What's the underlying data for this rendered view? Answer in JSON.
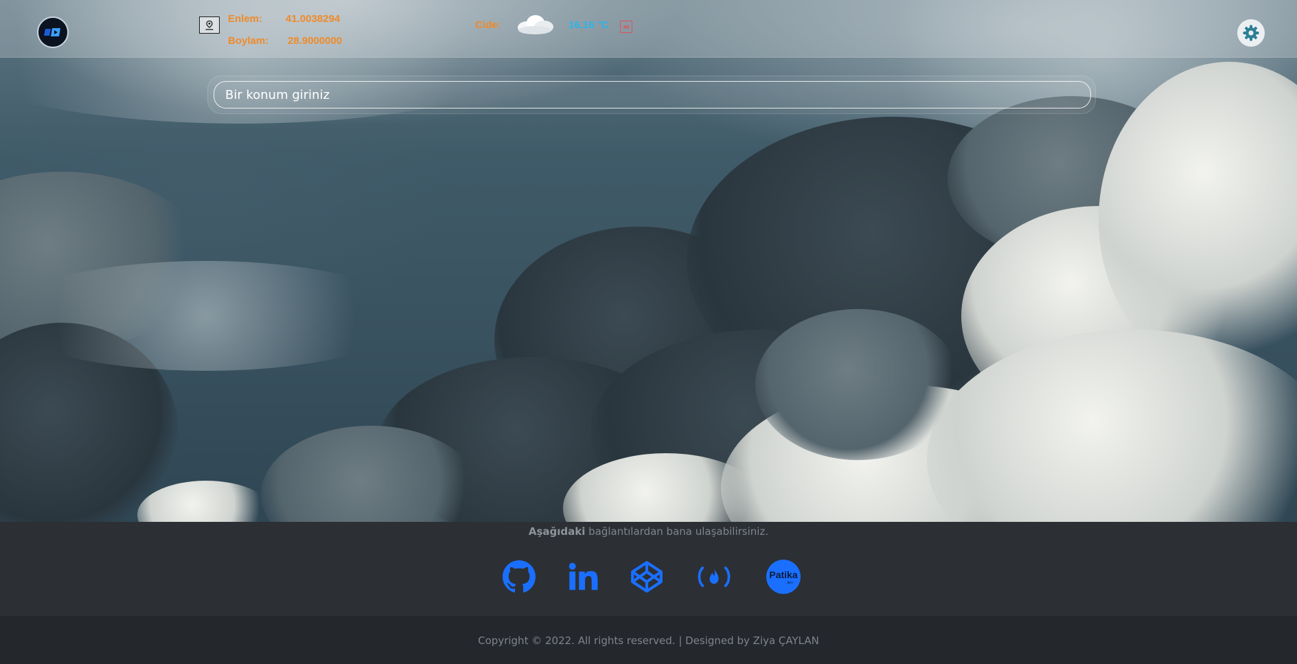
{
  "header": {
    "logo_alt": "logo",
    "location_icon": "map-pin-icon",
    "latitude_label": "Enlem:",
    "latitude_value": "41.0038294",
    "longitude_label": "Boylam:",
    "longitude_value": "28.9000000",
    "city": "Cide:",
    "weather_icon": "cloud-icon",
    "temperature": "16.16 °C",
    "settings_icon": "gear-icon"
  },
  "search": {
    "placeholder": "Bir konum giriniz"
  },
  "contact": {
    "intro_bold": "Aşağıdaki",
    "intro_rest": " bağlantılardan bana ulaşabilirsiniz.",
    "links": [
      {
        "name": "github",
        "icon": "github-icon"
      },
      {
        "name": "linkedin",
        "icon": "linkedin-icon"
      },
      {
        "name": "codepen",
        "icon": "codepen-icon"
      },
      {
        "name": "freecodecamp",
        "icon": "freecodecamp-icon"
      },
      {
        "name": "patika",
        "icon": "patika-icon",
        "label": "Patika"
      }
    ]
  },
  "footer": {
    "copyright": "Copyright © 2022. All rights reserved. | Designed by Ziya ÇAYLAN"
  },
  "colors": {
    "accent_orange": "#f08a2a",
    "temp_blue": "#29b6e8",
    "social_blue": "#1a6fff"
  }
}
